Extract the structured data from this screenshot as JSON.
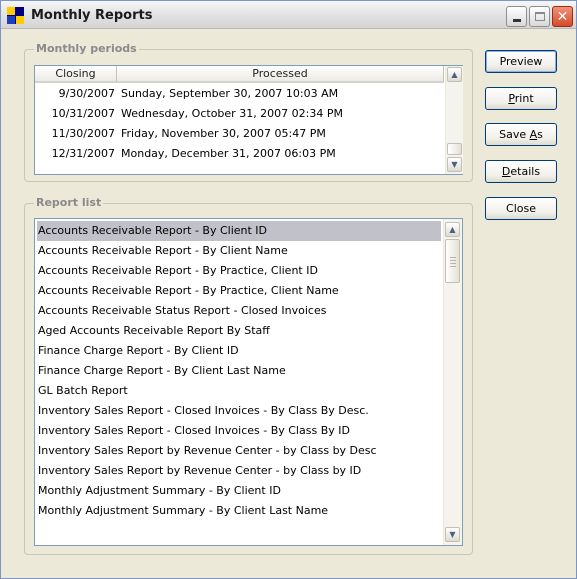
{
  "window": {
    "title": "Monthly Reports"
  },
  "periods": {
    "group_label": "Monthly periods",
    "columns": [
      "Closing",
      "Processed"
    ],
    "rows": [
      {
        "closing": "9/30/2007",
        "processed": "Sunday, September 30, 2007 10:03 AM"
      },
      {
        "closing": "10/31/2007",
        "processed": "Wednesday, October 31, 2007 02:34 PM"
      },
      {
        "closing": "11/30/2007",
        "processed": "Friday, November 30, 2007 05:47 PM"
      },
      {
        "closing": "12/31/2007",
        "processed": "Monday, December 31, 2007 06:03 PM"
      }
    ]
  },
  "reports": {
    "group_label": "Report list",
    "selected_index": 0,
    "items": [
      "Accounts Receivable Report - By Client ID",
      "Accounts Receivable Report - By Client Name",
      "Accounts Receivable Report - By Practice, Client ID",
      "Accounts Receivable Report - By Practice, Client Name",
      "Accounts Receivable Status Report - Closed Invoices",
      "Aged Accounts Receivable Report By Staff",
      "Finance Charge Report - By Client ID",
      "Finance Charge Report - By Client Last Name",
      "GL Batch Report",
      "Inventory Sales Report - Closed Invoices - By Class By Desc.",
      "Inventory Sales Report - Closed Invoices - By Class By ID",
      "Inventory Sales Report by Revenue Center - by Class by Desc",
      "Inventory Sales Report by Revenue Center - by Class by ID",
      "Monthly Adjustment Summary - By Client ID",
      "Monthly Adjustment Summary - By Client Last Name"
    ]
  },
  "buttons": {
    "preview": "Preview",
    "print_pre": "",
    "print_key": "P",
    "print_post": "rint",
    "saveas_pre": "Save ",
    "saveas_key": "A",
    "saveas_post": "s",
    "details_pre": "",
    "details_key": "D",
    "details_post": "etails",
    "close": "Close"
  },
  "colors": {
    "selection": "#c1c1c9",
    "window_bg": "#ece9d8",
    "button_border": "#003c74"
  },
  "icons": {
    "app": "app-icon",
    "minimize": "minimize-icon",
    "maximize": "maximize-icon",
    "close": "close-icon",
    "scroll_up": "chevron-up-icon",
    "scroll_down": "chevron-down-icon"
  }
}
